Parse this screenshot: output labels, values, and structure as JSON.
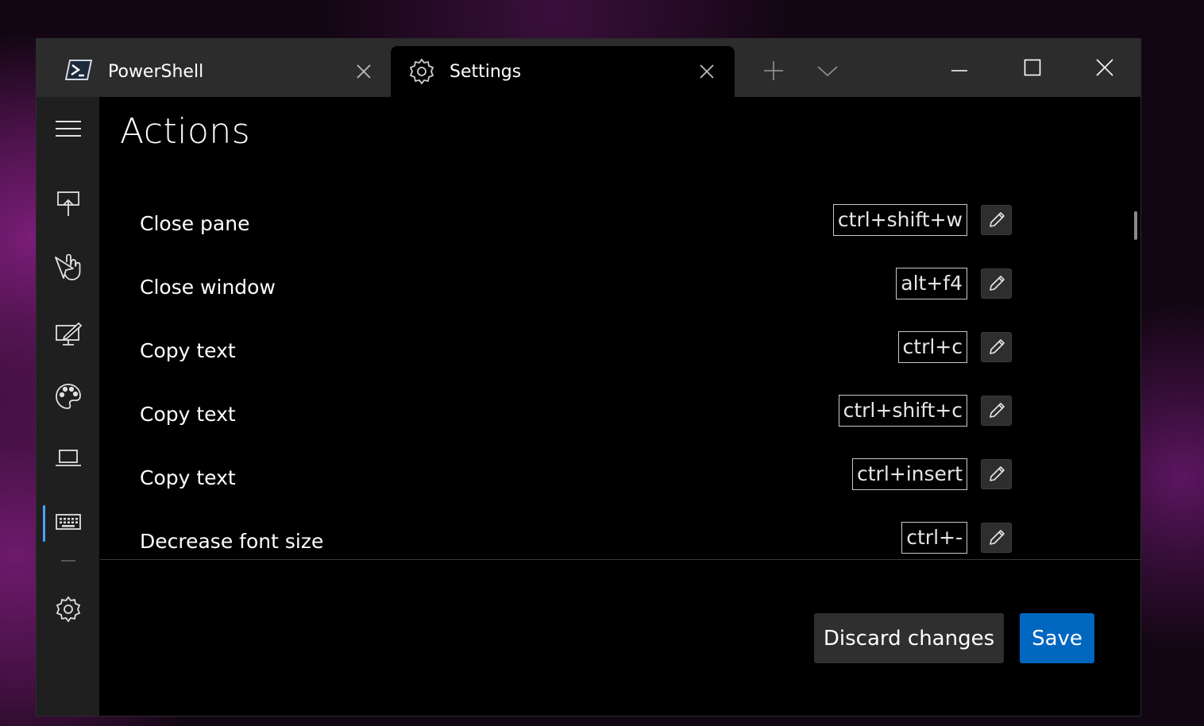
{
  "colors": {
    "accent": "#0067c0",
    "nav_indicator": "#4aa3ff",
    "tab_active_bg": "#000000",
    "tab_bar_bg": "#2c2c2c"
  },
  "tabs": [
    {
      "title": "PowerShell",
      "icon": "powershell-icon",
      "active": false
    },
    {
      "title": "Settings",
      "icon": "gear-icon",
      "active": true
    }
  ],
  "nav": {
    "items": [
      {
        "icon": "hamburger-menu-icon"
      },
      {
        "icon": "startup-icon"
      },
      {
        "icon": "interaction-icon"
      },
      {
        "icon": "rendering-icon"
      },
      {
        "icon": "color-palette-icon"
      },
      {
        "icon": "laptop-icon"
      },
      {
        "icon": "keyboard-icon",
        "selected": true
      },
      {
        "icon": "gear-icon"
      }
    ]
  },
  "page": {
    "title": "Actions",
    "actions": [
      {
        "label": "Close pane",
        "keys": "ctrl+shift+w"
      },
      {
        "label": "Close window",
        "keys": "alt+f4"
      },
      {
        "label": "Copy text",
        "keys": "ctrl+c"
      },
      {
        "label": "Copy text",
        "keys": "ctrl+shift+c"
      },
      {
        "label": "Copy text",
        "keys": "ctrl+insert"
      },
      {
        "label": "Decrease font size",
        "keys": "ctrl+-"
      }
    ]
  },
  "footer": {
    "discard_label": "Discard changes",
    "save_label": "Save"
  }
}
